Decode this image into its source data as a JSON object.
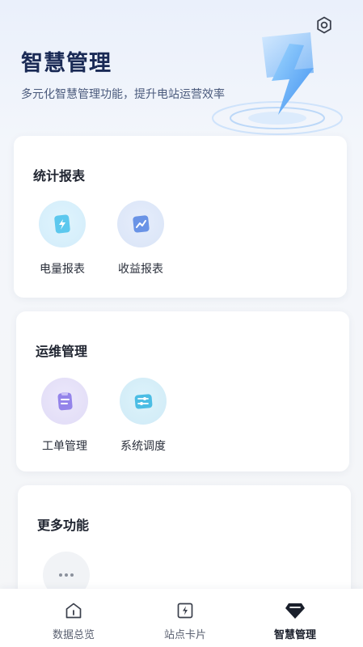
{
  "header": {
    "title": "智慧管理",
    "subtitle": "多元化智慧管理功能，提升电站运营效率",
    "settings_icon": "gear-icon",
    "hero_icon": "lightning-bolt-icon"
  },
  "sections": {
    "stats": {
      "title": "统计报表",
      "items": [
        {
          "label": "电量报表",
          "icon": "power-report-icon",
          "color": "#4fc3e8"
        },
        {
          "label": "收益报表",
          "icon": "revenue-chart-icon",
          "color": "#5b86e0"
        }
      ]
    },
    "ops": {
      "title": "运维管理",
      "items": [
        {
          "label": "工单管理",
          "icon": "work-order-icon",
          "color": "#8f7de6"
        },
        {
          "label": "系统调度",
          "icon": "dispatch-sliders-icon",
          "color": "#43b8df"
        }
      ]
    },
    "more": {
      "title": "更多功能",
      "items": [
        {
          "label": "",
          "icon": "more-dots-icon"
        }
      ]
    }
  },
  "tabbar": {
    "tabs": [
      {
        "label": "数据总览",
        "icon": "home-icon",
        "active": false
      },
      {
        "label": "站点卡片",
        "icon": "lightning-card-icon",
        "active": false
      },
      {
        "label": "智慧管理",
        "icon": "diamond-icon",
        "active": true
      }
    ]
  },
  "colors": {
    "accent": "#1a2a55",
    "background": "#f4f6f9",
    "card": "#ffffff"
  }
}
